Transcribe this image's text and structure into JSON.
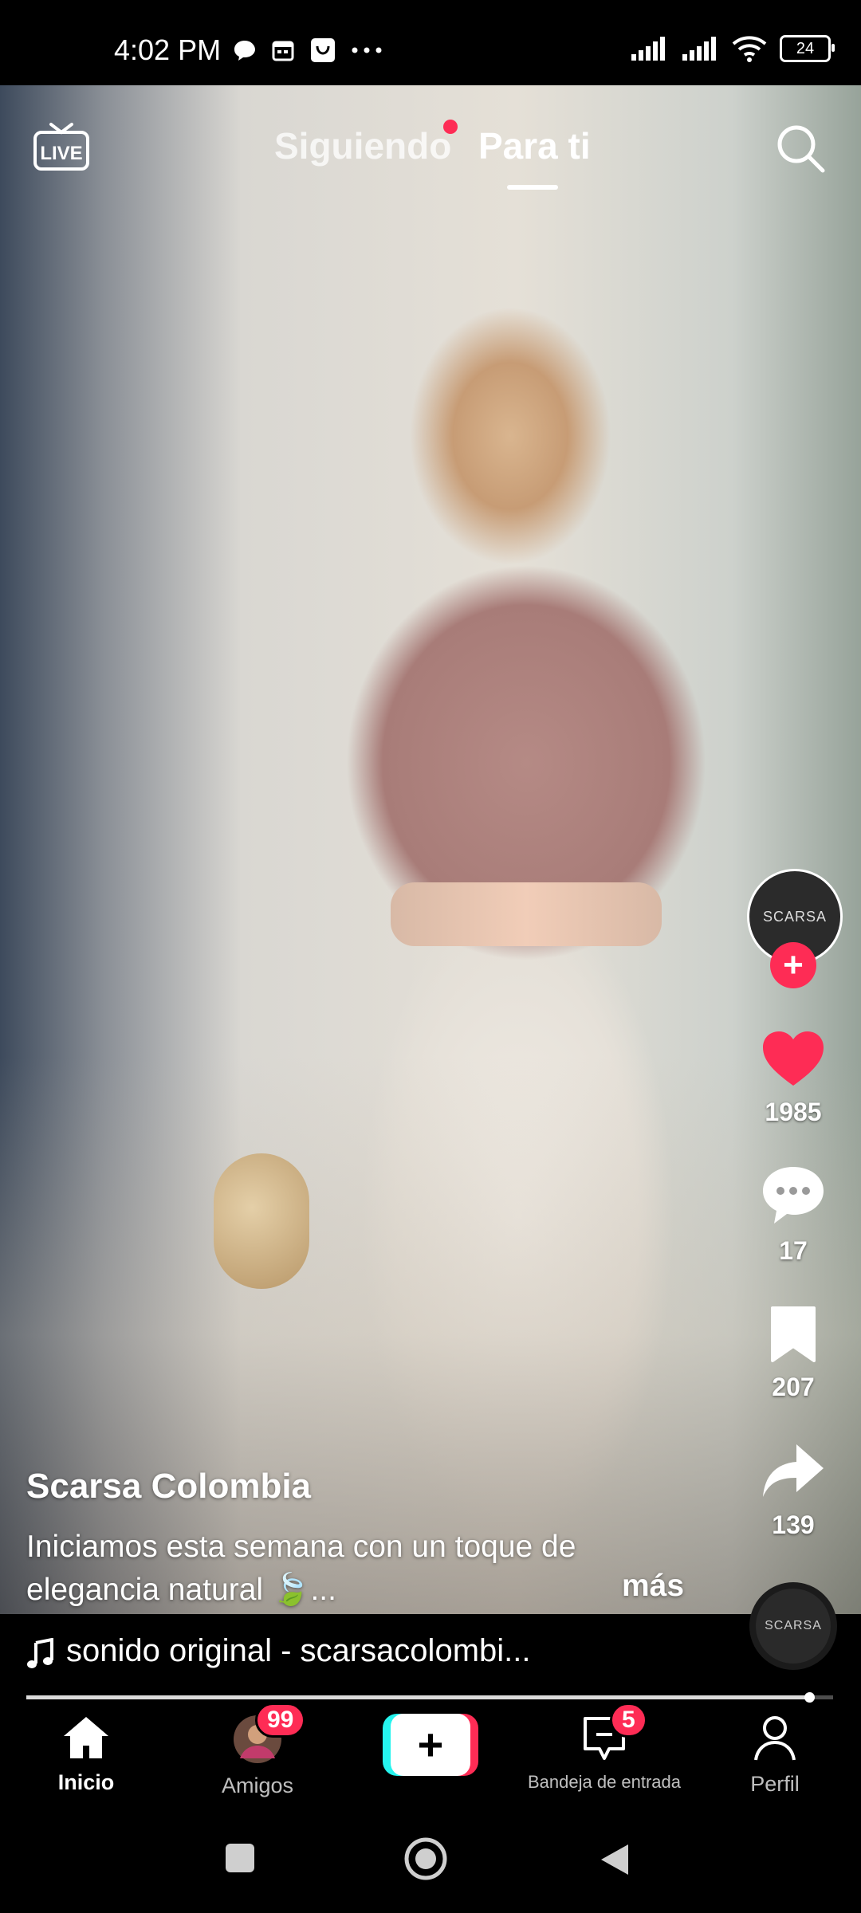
{
  "status_bar": {
    "time": "4:02 PM",
    "battery": "24",
    "left_icons": [
      "chat-bubble-icon",
      "calendar-icon",
      "shopping-bag-icon",
      "more-dots-icon"
    ],
    "right_icons": [
      "signal-icon",
      "signal-icon",
      "wifi-icon",
      "battery-icon"
    ]
  },
  "top_nav": {
    "live_label": "LIVE",
    "following_tab": "Siguiendo",
    "for_you_tab": "Para ti",
    "active_tab": "Para ti"
  },
  "creator": {
    "avatar_text": "SCARSA"
  },
  "actions": {
    "likes": "1985",
    "comments": "17",
    "saves": "207",
    "shares": "139"
  },
  "post": {
    "author": "Scarsa Colombia",
    "caption_line1": "Iniciamos esta semana con un toque de",
    "caption_line2": "elegancia natural 🍃...",
    "more": "más"
  },
  "music": {
    "title": "sonido original - scarsacolombi...",
    "disc_text": "SCARSA"
  },
  "progress": {
    "fraction": 0.97
  },
  "bottom_nav": {
    "home": "Inicio",
    "friends": "Amigos",
    "friends_badge": "99",
    "inbox": "Bandeja de entrada",
    "inbox_badge": "5",
    "profile": "Perfil",
    "create_symbol": "+"
  },
  "colors": {
    "accent_red": "#fe2c55",
    "accent_cyan": "#25f4ee"
  }
}
